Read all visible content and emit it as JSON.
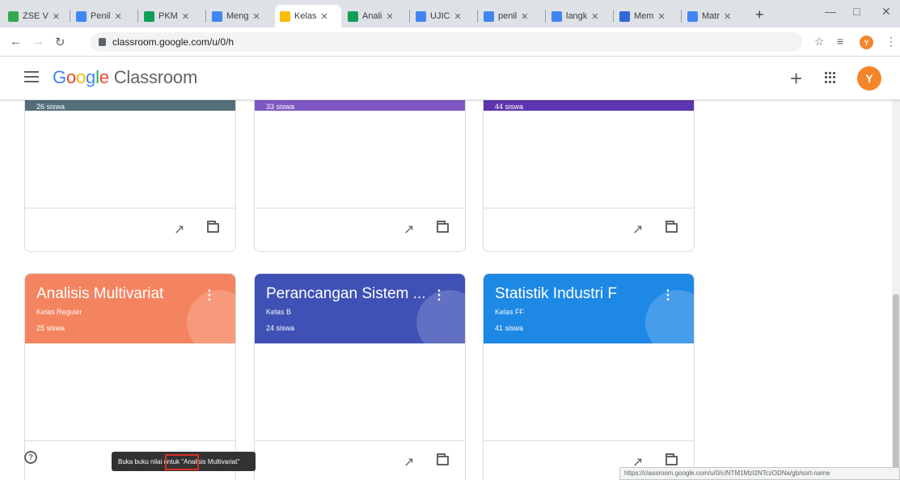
{
  "browser": {
    "tabs": [
      {
        "label": "ZSE V",
        "fav_color": "#34a853"
      },
      {
        "label": "Penil",
        "fav_color": "#4285f4"
      },
      {
        "label": "PKM",
        "fav_color": "#0f9d58"
      },
      {
        "label": "Meng",
        "fav_color": "#4285f4"
      },
      {
        "label": "Kelas",
        "fav_color": "#fbbc05"
      },
      {
        "label": "Anali",
        "fav_color": "#0f9d58"
      },
      {
        "label": "UJIC",
        "fav_color": "#4285f4"
      },
      {
        "label": "penil",
        "fav_color": "#4285f4"
      },
      {
        "label": "langk",
        "fav_color": "#4285f4"
      },
      {
        "label": "Mem",
        "fav_color": "#3367d6"
      },
      {
        "label": "Matr",
        "fav_color": "#4285f4"
      }
    ],
    "url": "classroom.google.com/u/0/h",
    "profile_initial": "Y"
  },
  "app": {
    "brand_google": "Google",
    "brand_classroom": "Classroom",
    "avatar_initial": "Y",
    "accent": "#f4862a"
  },
  "top_cards": [
    {
      "count": "26 siswa",
      "color": "#546e7a"
    },
    {
      "count": "33 siswa",
      "color": "#7e57c2"
    },
    {
      "count": "44 siswa",
      "color": "#5e35b1"
    }
  ],
  "cards": [
    {
      "title": "Analisis Multivariat",
      "section": "Kelas Reguler",
      "count": "25 siswa",
      "color": "#f4845f"
    },
    {
      "title": "Perancangan Sistem ...",
      "section": "Kelas B",
      "count": "24 siswa",
      "color": "#3f51b5"
    },
    {
      "title": "Statistik Industri F",
      "section": "Kelas FF",
      "count": "41 siswa",
      "color": "#1e88e5"
    }
  ],
  "snackbar": {
    "text": "Buka buku nilai untuk \"Analisis Multivariat\""
  },
  "status_url": "https://classroom.google.com/u/0/c/NTM1MzI2NTczODNa/gb/sort-name"
}
